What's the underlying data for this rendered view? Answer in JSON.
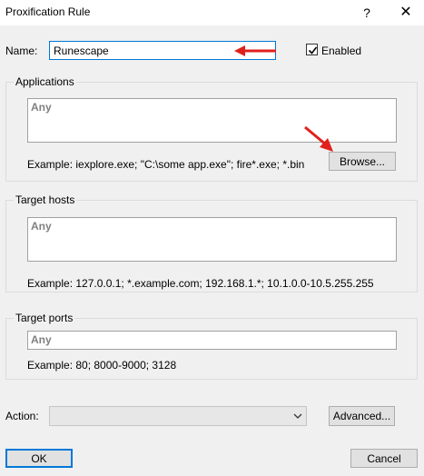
{
  "window": {
    "title": "Proxification Rule",
    "help_glyph": "?",
    "close_glyph": "✕"
  },
  "name": {
    "label": "Name:",
    "value": "Runescape"
  },
  "enabled": {
    "label": "Enabled",
    "checked": true
  },
  "applications": {
    "title": "Applications",
    "value": "Any",
    "example": "Example: iexplore.exe; \"C:\\some app.exe\"; fire*.exe; *.bin",
    "browse_label": "Browse..."
  },
  "target_hosts": {
    "title": "Target hosts",
    "value": "Any",
    "example": "Example: 127.0.0.1; *.example.com; 192.168.1.*; 10.1.0.0-10.5.255.255"
  },
  "target_ports": {
    "title": "Target ports",
    "value": "Any",
    "example": "Example: 80; 8000-9000; 3128"
  },
  "action": {
    "label": "Action:",
    "value": "",
    "advanced_label": "Advanced..."
  },
  "buttons": {
    "ok_label": "OK",
    "cancel_label": "Cancel"
  },
  "colors": {
    "annotation_arrow": "#e0201c",
    "focus_border": "#0078d7"
  },
  "icons": {
    "check": "checkmark-icon",
    "dropdown": "chevron-down-icon",
    "annotation": "red-arrow-icon"
  }
}
